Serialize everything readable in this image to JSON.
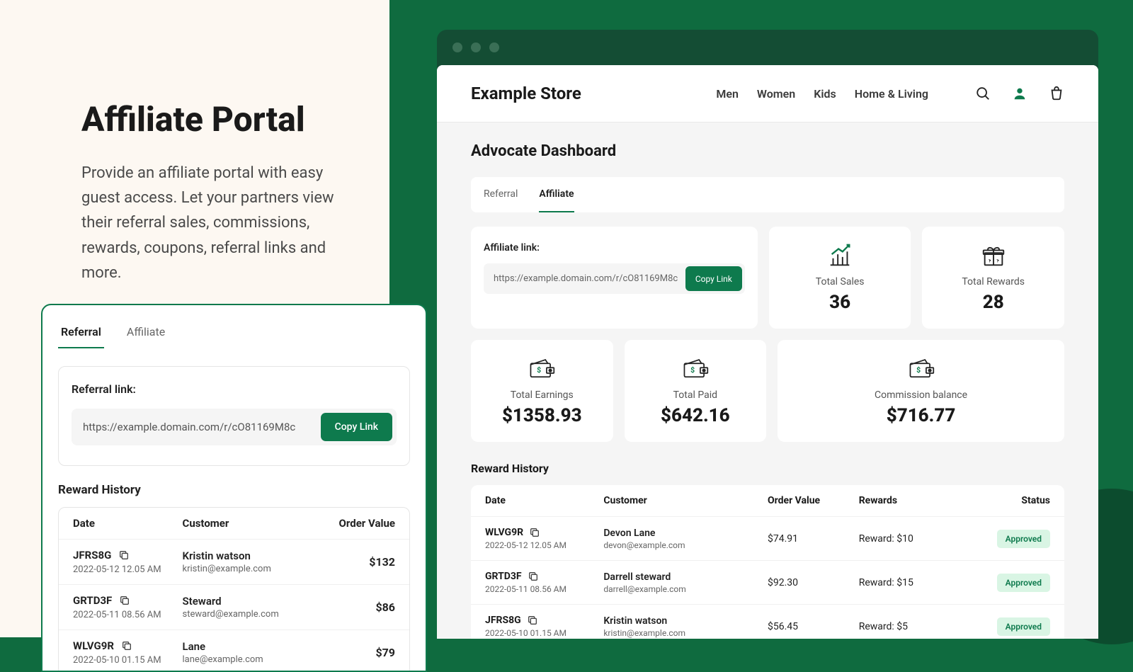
{
  "left": {
    "title": "Affiliate Portal",
    "subtitle": "Provide an affiliate portal with easy guest access. Let your partners view their referral sales, commissions, rewards, coupons, referral links and more."
  },
  "smallCard": {
    "tabs": [
      "Referral",
      "Affiliate"
    ],
    "activeTab": 0,
    "linkLabel": "Referral link:",
    "linkValue": "https://example.domain.com/r/cO81169M8c",
    "copyLabel": "Copy Link",
    "historyTitle": "Reward History",
    "columns": [
      "Date",
      "Customer",
      "Order Value"
    ],
    "rows": [
      {
        "code": "JFRS8G",
        "date": "2022-05-12 12.05 AM",
        "name": "Kristin watson",
        "email": "kristin@example.com",
        "value": "$132"
      },
      {
        "code": "GRTD3F",
        "date": "2022-05-11 08.56 AM",
        "name": "Steward",
        "email": "steward@example.com",
        "value": "$86"
      },
      {
        "code": "WLVG9R",
        "date": "2022-05-10 01.15 AM",
        "name": "Lane",
        "email": "lane@example.com",
        "value": "$79"
      }
    ]
  },
  "store": {
    "name": "Example Store",
    "nav": [
      "Men",
      "Women",
      "Kids",
      "Home & Living"
    ]
  },
  "dashboard": {
    "title": "Advocate Dashboard",
    "tabs": [
      "Referral",
      "Affiliate"
    ],
    "activeTab": 1,
    "affiliateLink": {
      "label": "Affiliate link:",
      "value": "https://example.domain.com/r/cO81169M8c",
      "copyLabel": "Copy Link"
    },
    "stats": {
      "totalSales": {
        "label": "Total Sales",
        "value": "36"
      },
      "totalRewards": {
        "label": "Total Rewards",
        "value": "28"
      },
      "totalEarnings": {
        "label": "Total Earnings",
        "value": "$1358.93"
      },
      "totalPaid": {
        "label": "Total Paid",
        "value": "$642.16"
      },
      "commissionBalance": {
        "label": "Commission balance",
        "value": "$716.77"
      }
    },
    "historyTitle": "Reward History",
    "columns": [
      "Date",
      "Customer",
      "Order Value",
      "Rewards",
      "Status"
    ],
    "rows": [
      {
        "code": "WLVG9R",
        "date": "2022-05-12 12.05 AM",
        "name": "Devon Lane",
        "email": "devon@example.com",
        "orderValue": "$74.91",
        "reward": "Reward: $10",
        "status": "Approved"
      },
      {
        "code": "GRTD3F",
        "date": "2022-05-11 08.56 AM",
        "name": "Darrell steward",
        "email": "darrell@example.com",
        "orderValue": "$92.30",
        "reward": "Reward: $15",
        "status": "Approved"
      },
      {
        "code": "JFRS8G",
        "date": "2022-05-10 01.15 AM",
        "name": "Kristin watson",
        "email": "kristin@example.com",
        "orderValue": "$56.45",
        "reward": "Reward: $5",
        "status": "Approved"
      }
    ]
  }
}
